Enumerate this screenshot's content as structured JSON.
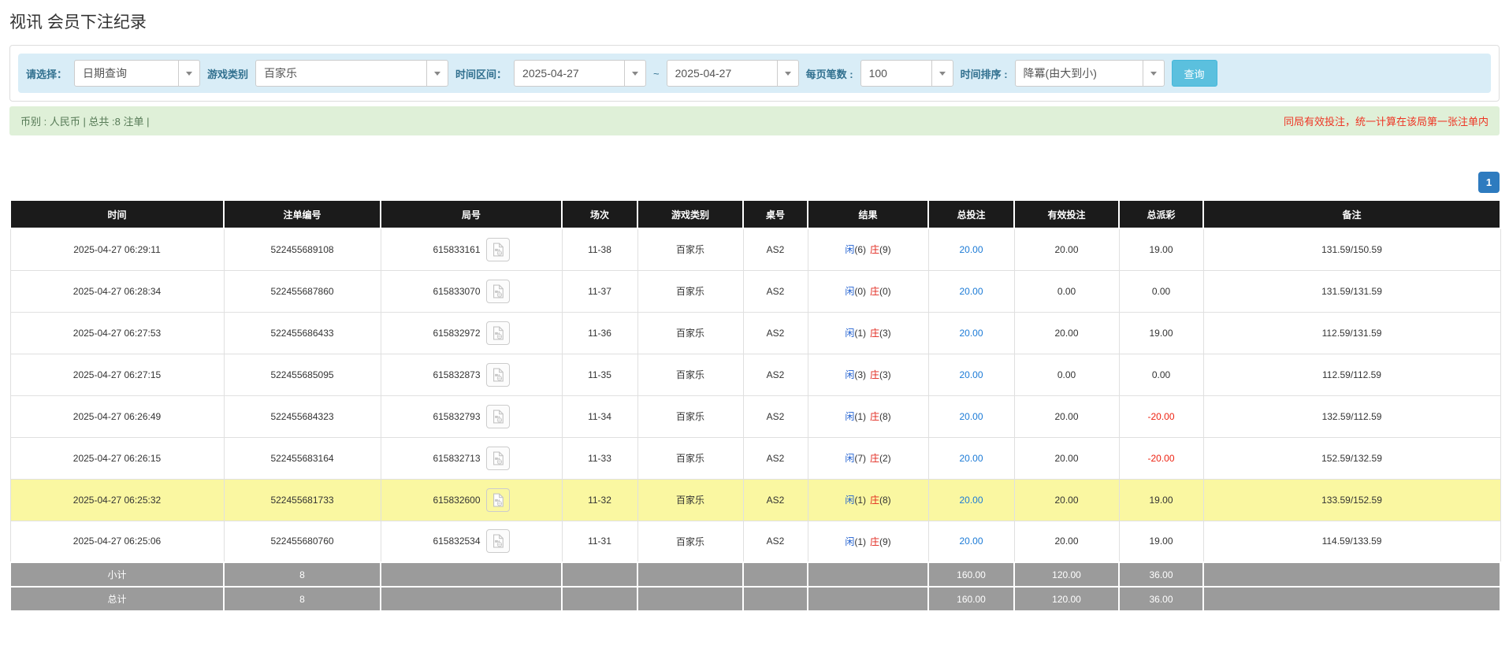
{
  "page": {
    "title": "视讯 会员下注纪录"
  },
  "filters": {
    "select_label": "请选择：",
    "select_value": "日期查询",
    "game_type_label": "游戏类别",
    "game_type_value": "百家乐",
    "time_range_label": "时间区间：",
    "date_from": "2025-04-27",
    "range_separator": "~",
    "date_to": "2025-04-27",
    "page_size_label": "每页笔数 :",
    "page_size_value": "100",
    "sort_label": "时间排序 :",
    "sort_value": "降冪(由大到小)",
    "search_button": "查询"
  },
  "summary_bar": {
    "left": "币别 : 人民币 | 总共 :8 注单 |",
    "right_note": "同局有效投注，统一计算在该局第一张注单内"
  },
  "pagination": {
    "page": "1"
  },
  "table": {
    "headers": [
      "时间",
      "注单编号",
      "局号",
      "场次",
      "游戏类别",
      "桌号",
      "结果",
      "总投注",
      "有效投注",
      "总派彩",
      "备注"
    ],
    "rows": [
      {
        "time": "2025-04-27 06:29:11",
        "bet_id": "522455689108",
        "round": "615833161",
        "session": "11-38",
        "game": "百家乐",
        "table_no": "AS2",
        "player_label": "闲",
        "player_score": "(6)",
        "banker_label": "庄",
        "banker_score": "(9)",
        "total_bet": "20.00",
        "valid_bet": "20.00",
        "payout": "19.00",
        "remark": "131.59/150.59",
        "highlight": false
      },
      {
        "time": "2025-04-27 06:28:34",
        "bet_id": "522455687860",
        "round": "615833070",
        "session": "11-37",
        "game": "百家乐",
        "table_no": "AS2",
        "player_label": "闲",
        "player_score": "(0)",
        "banker_label": "庄",
        "banker_score": "(0)",
        "total_bet": "20.00",
        "valid_bet": "0.00",
        "payout": "0.00",
        "remark": "131.59/131.59",
        "highlight": false
      },
      {
        "time": "2025-04-27 06:27:53",
        "bet_id": "522455686433",
        "round": "615832972",
        "session": "11-36",
        "game": "百家乐",
        "table_no": "AS2",
        "player_label": "闲",
        "player_score": "(1)",
        "banker_label": "庄",
        "banker_score": "(3)",
        "total_bet": "20.00",
        "valid_bet": "20.00",
        "payout": "19.00",
        "remark": "112.59/131.59",
        "highlight": false
      },
      {
        "time": "2025-04-27 06:27:15",
        "bet_id": "522455685095",
        "round": "615832873",
        "session": "11-35",
        "game": "百家乐",
        "table_no": "AS2",
        "player_label": "闲",
        "player_score": "(3)",
        "banker_label": "庄",
        "banker_score": "(3)",
        "total_bet": "20.00",
        "valid_bet": "0.00",
        "payout": "0.00",
        "remark": "112.59/112.59",
        "highlight": false
      },
      {
        "time": "2025-04-27 06:26:49",
        "bet_id": "522455684323",
        "round": "615832793",
        "session": "11-34",
        "game": "百家乐",
        "table_no": "AS2",
        "player_label": "闲",
        "player_score": "(1)",
        "banker_label": "庄",
        "banker_score": "(8)",
        "total_bet": "20.00",
        "valid_bet": "20.00",
        "payout": "-20.00",
        "remark": "132.59/112.59",
        "highlight": false
      },
      {
        "time": "2025-04-27 06:26:15",
        "bet_id": "522455683164",
        "round": "615832713",
        "session": "11-33",
        "game": "百家乐",
        "table_no": "AS2",
        "player_label": "闲",
        "player_score": "(7)",
        "banker_label": "庄",
        "banker_score": "(2)",
        "total_bet": "20.00",
        "valid_bet": "20.00",
        "payout": "-20.00",
        "remark": "152.59/132.59",
        "highlight": false
      },
      {
        "time": "2025-04-27 06:25:32",
        "bet_id": "522455681733",
        "round": "615832600",
        "session": "11-32",
        "game": "百家乐",
        "table_no": "AS2",
        "player_label": "闲",
        "player_score": "(1)",
        "banker_label": "庄",
        "banker_score": "(8)",
        "total_bet": "20.00",
        "valid_bet": "20.00",
        "payout": "19.00",
        "remark": "133.59/152.59",
        "highlight": true
      },
      {
        "time": "2025-04-27 06:25:06",
        "bet_id": "522455680760",
        "round": "615832534",
        "session": "11-31",
        "game": "百家乐",
        "table_no": "AS2",
        "player_label": "闲",
        "player_score": "(1)",
        "banker_label": "庄",
        "banker_score": "(9)",
        "total_bet": "20.00",
        "valid_bet": "20.00",
        "payout": "19.00",
        "remark": "114.59/133.59",
        "highlight": false
      }
    ],
    "subtotal": {
      "label": "小计",
      "count": "8",
      "total_bet": "160.00",
      "valid_bet": "120.00",
      "payout": "36.00"
    },
    "total": {
      "label": "总计",
      "count": "8",
      "total_bet": "160.00",
      "valid_bet": "120.00",
      "payout": "36.00"
    }
  },
  "icons": {
    "dropdown_caret": "chevron-down-icon",
    "round_video": "video-file-icon"
  },
  "colors": {
    "header_bg": "#1b1b1b",
    "summary_row_bg": "#9b9b9b",
    "highlight_yellow": "#faf7a1",
    "link_blue": "#1b7ad6",
    "player_blue": "#2060d0",
    "banker_red": "#e1251b",
    "negative_red": "#ee2211",
    "note_red": "#ee3524",
    "filter_bar_bg": "#d9edf7",
    "filter_label": "#31708f",
    "search_button_bg": "#5bc0de",
    "info_bar_bg": "#dff0d8",
    "pagination_bg": "#2e7bbf"
  }
}
